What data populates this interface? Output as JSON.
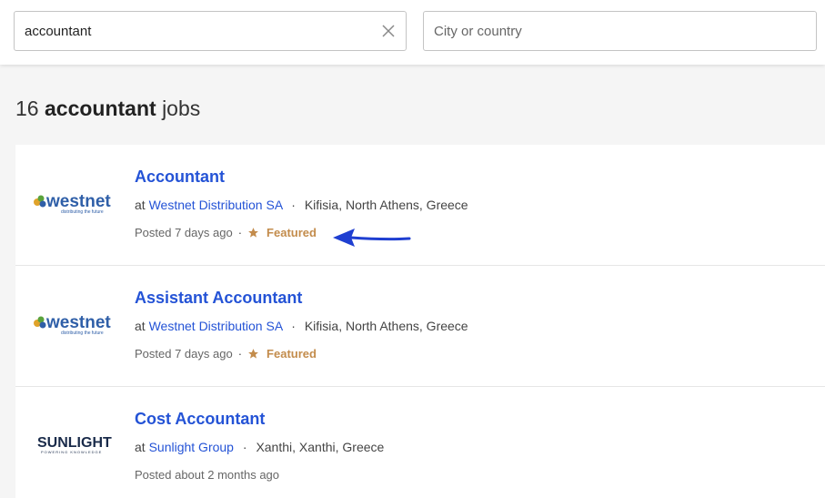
{
  "search": {
    "keyword_value": "accountant",
    "location_placeholder": "City or country"
  },
  "results": {
    "count": "16",
    "keyword": "accountant",
    "suffix": "jobs"
  },
  "jobs": [
    {
      "title": "Accountant",
      "at": "at",
      "company": "Westnet Distribution SA",
      "location": "Kifisia, North Athens, Greece",
      "posted": "Posted 7 days ago",
      "featured": "Featured",
      "logo_text": "westnet",
      "logo_tagline": "distributing the future"
    },
    {
      "title": "Assistant Accountant",
      "at": "at",
      "company": "Westnet Distribution SA",
      "location": "Kifisia, North Athens, Greece",
      "posted": "Posted 7 days ago",
      "featured": "Featured",
      "logo_text": "westnet",
      "logo_tagline": "distributing the future"
    },
    {
      "title": "Cost Accountant",
      "at": "at",
      "company": "Sunlight Group",
      "location": "Xanthi, Xanthi, Greece",
      "posted": "Posted about 2 months ago",
      "logo_text": "SUNLIGHT",
      "logo_tagline": "POWERING KNOWLEDGE"
    }
  ],
  "separator": "·",
  "colors": {
    "link": "#2453d6",
    "featured": "#c38c4c",
    "arrow": "#1f3fd1",
    "westnet_blue": "#2f5fa8"
  },
  "icons": {
    "clear": "close-icon",
    "featured": "star-icon",
    "annotation": "arrow-icon"
  }
}
